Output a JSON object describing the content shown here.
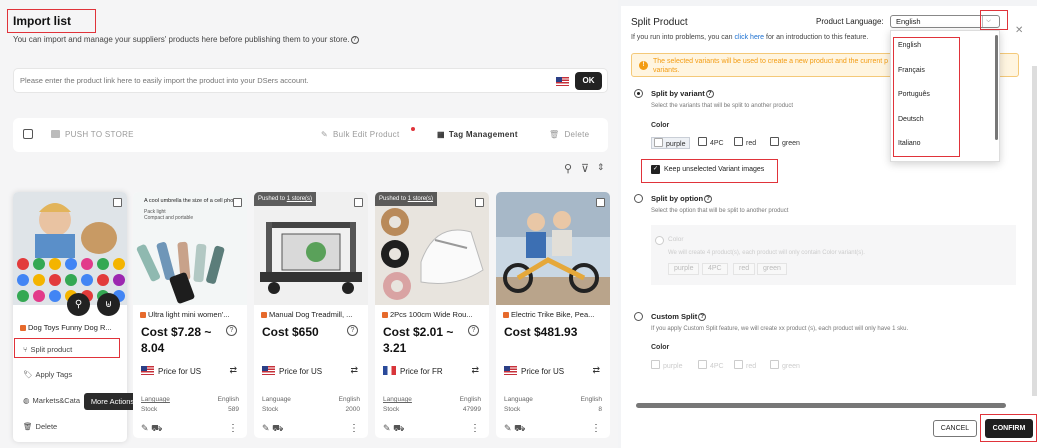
{
  "import_list": {
    "title": "Import list",
    "subtitle": "You can import and manage your suppliers' products here before publishing them to your store.",
    "import_placeholder": "Please enter the product link here to easily import the product into your DSers account.",
    "ok_label": "OK",
    "push_label": "PUSH TO STORE",
    "bulk_edit_label": "Bulk Edit Product",
    "tag_management_label": "Tag Management",
    "delete_label": "Delete"
  },
  "first_card": {
    "title": "Dog Toys Funny Dog R...",
    "menu": {
      "split": "Split product",
      "tags": "Apply Tags",
      "markets": "Markets&Cata",
      "delete": "Delete"
    },
    "tooltip": "More Actions"
  },
  "cards": [
    {
      "banner_line1": "A cool umbrella the size of a cell phone",
      "banner_line2": "Pack light",
      "banner_line3": "Compact and portable",
      "title": "Ultra light mini women'...",
      "cost_line1": "Cost $7.28 ~",
      "cost_line2": "8.04",
      "price_for": "Price for US",
      "language_label": "Language",
      "language_value": "English",
      "stock_label": "Stock",
      "stock_value": "589"
    },
    {
      "pushed_prefix": "Pushed to ",
      "pushed_link": "1 store(s)",
      "title": "Manual Dog Treadmill, ...",
      "cost_line1": "Cost $650",
      "cost_line2": "",
      "price_for": "Price for US",
      "language_label": "Language",
      "language_value": "English",
      "stock_label": "Stock",
      "stock_value": "2000"
    },
    {
      "pushed_prefix": "Pushed to ",
      "pushed_link": "1 store(s)",
      "title": "2Pcs 100cm Wide Rou...",
      "cost_line1": "Cost $2.01 ~",
      "cost_line2": "3.21",
      "price_for": "Price for FR",
      "language_label": "Language",
      "language_value": "English",
      "stock_label": "Stock",
      "stock_value": "47999"
    },
    {
      "title": "Electric Trike Bike, Pea...",
      "cost_line1": "Cost $481.93",
      "cost_line2": "",
      "price_for": "Price for US",
      "language_label": "Language",
      "language_value": "English",
      "stock_label": "Stock",
      "stock_value": "8"
    }
  ],
  "modal": {
    "title": "Split Product",
    "language_label": "Product Language:",
    "language_value": "English",
    "help_prefix": "If you run into problems, you can ",
    "help_link": "click here",
    "help_suffix": " for an introduction to this feature.",
    "warning_line1": "The selected variants will be used to create a new product and the current p",
    "warning_line2": "variants.",
    "split_variant": {
      "title": "Split by variant",
      "desc": "Select the variants that will be split to another product",
      "color_label": "Color",
      "chips": [
        "purple",
        "4PC",
        "red",
        "green"
      ],
      "keep_label": "Keep unselected Variant images"
    },
    "split_option": {
      "title": "Split by option",
      "desc": "Select the option that will be split to another product",
      "color_label": "Color",
      "color_desc": "We will create 4 product(s), each product will only contain Color variant(s).",
      "pills": [
        "purple",
        "4PC",
        "red",
        "green"
      ]
    },
    "custom_split": {
      "title": "Custom Split",
      "desc": "If you apply Custom Split feature, we will create xx product (s), each product will only have 1 sku.",
      "color_label": "Color",
      "chips": [
        "purple",
        "4PC",
        "red",
        "green"
      ]
    },
    "cancel_label": "CANCEL",
    "confirm_label": "CONFIRM"
  },
  "language_dropdown": {
    "options": [
      "English",
      "Français",
      "Português",
      "Deutsch",
      "Italiano"
    ]
  },
  "colors": {
    "highlight": "#e0333a",
    "warning": "#f39c12",
    "primary_dark": "#1f1f1f",
    "link": "#1b6fd0"
  }
}
